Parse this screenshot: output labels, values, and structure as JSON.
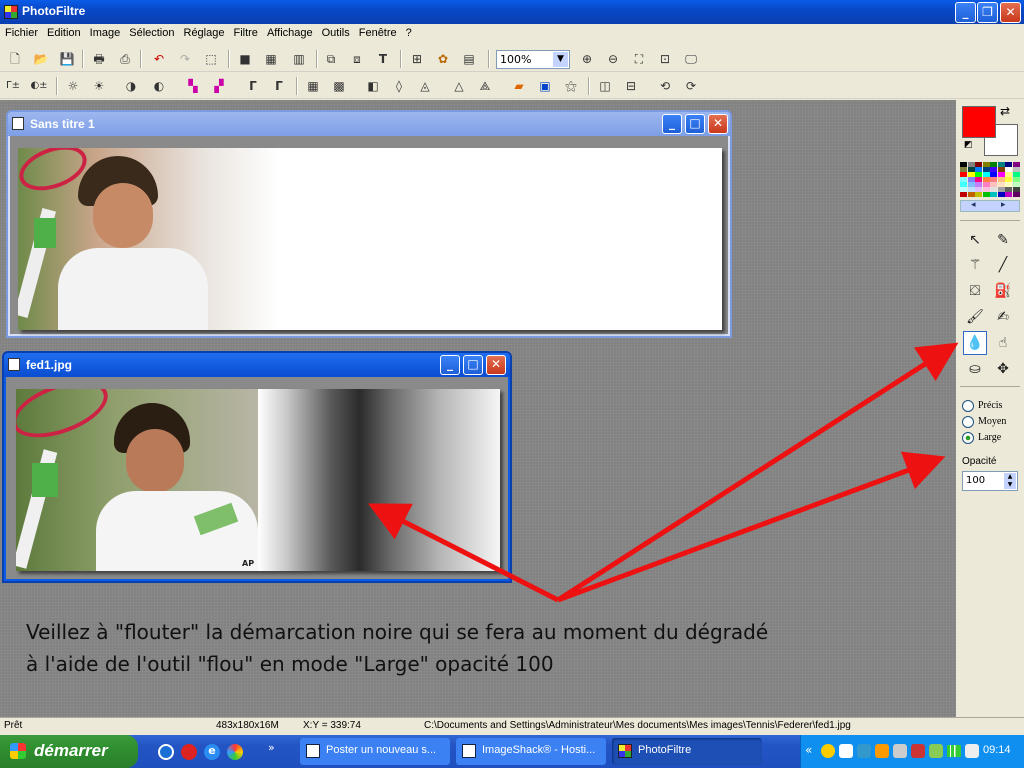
{
  "app": {
    "title": "PhotoFiltre"
  },
  "menu": [
    "Fichier",
    "Edition",
    "Image",
    "Sélection",
    "Réglage",
    "Filtre",
    "Affichage",
    "Outils",
    "Fenêtre",
    "?"
  ],
  "toolbar": {
    "zoom_value": "100%"
  },
  "windows": [
    {
      "title": "Sans titre 1"
    },
    {
      "title": "fed1.jpg",
      "photo_watermark": "AP"
    }
  ],
  "palette": {
    "foreground": "#ff0000",
    "background": "#ffffff",
    "colors": [
      "#000000",
      "#808080",
      "#800000",
      "#808000",
      "#008000",
      "#008080",
      "#000080",
      "#800080",
      "#808040",
      "#004040",
      "#0080ff",
      "#004080",
      "#4000ff",
      "#804000",
      "#ffffff",
      "#c0c0c0",
      "#ff0000",
      "#ffff00",
      "#00ff00",
      "#00ffff",
      "#0000ff",
      "#ff00ff",
      "#ffff80",
      "#00ff80",
      "#80ffff",
      "#8080ff",
      "#ff0080",
      "#ff8040",
      "#ff8080",
      "#ffc080",
      "#ffff40",
      "#80ff80",
      "#40ffff",
      "#80c0ff",
      "#c080ff",
      "#ff80c0",
      "#ffc0c0",
      "#ffe0c0",
      "#ffffc0",
      "#c0ffc0",
      "#c0ffff",
      "#c0e0ff",
      "#e0c0ff",
      "#ffc0e0",
      "#e0e0e0",
      "#a0a0a0",
      "#606060",
      "#404040",
      "#c00000",
      "#c06000",
      "#c0c000",
      "#00c000",
      "#00c0c0",
      "#0000c0",
      "#c000c0",
      "#600060"
    ]
  },
  "options": {
    "modes": [
      "Précis",
      "Moyen",
      "Large"
    ],
    "selected_mode": "Large",
    "opacity_label": "Opacité",
    "opacity_value": "100"
  },
  "status": {
    "state": "Prêt",
    "size": "483x180x16M",
    "coords": "X:Y = 339:74",
    "path": "C:\\Documents and Settings\\Administrateur\\Mes documents\\Mes images\\Tennis\\Federer\\fed1.jpg"
  },
  "annotation": {
    "line1": "Veillez à \"flouter\" la démarcation noire qui se fera au moment du dégradé",
    "line2": "à l'aide de l'outil \"flou\" en mode \"Large\" opacité 100",
    "arrow_color": "#ee1111"
  },
  "taskbar": {
    "start": "démarrer",
    "buttons": [
      "Poster un nouveau s...",
      "ImageShack® - Hosti...",
      "PhotoFiltre"
    ],
    "clock": "09:14"
  }
}
